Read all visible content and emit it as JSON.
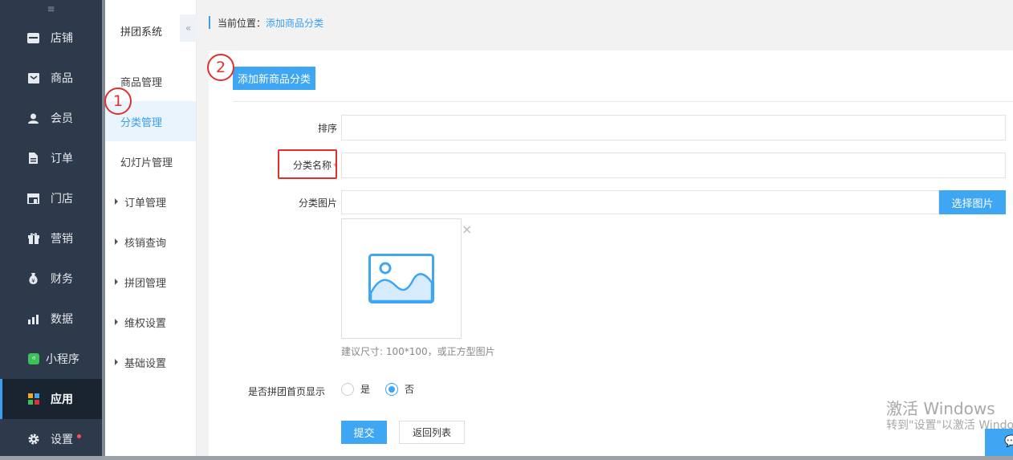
{
  "sidebar": {
    "toggle_icon": "≡",
    "items": [
      {
        "label": "店铺",
        "icon": "store-icon"
      },
      {
        "label": "商品",
        "icon": "goods-icon"
      },
      {
        "label": "会员",
        "icon": "member-icon"
      },
      {
        "label": "订单",
        "icon": "order-icon"
      },
      {
        "label": "门店",
        "icon": "shop-icon"
      },
      {
        "label": "营销",
        "icon": "gift-icon"
      },
      {
        "label": "财务",
        "icon": "money-icon"
      },
      {
        "label": "数据",
        "icon": "chart-icon"
      },
      {
        "label": "小程序",
        "icon": "miniapp-icon"
      },
      {
        "label": "应用",
        "icon": "apps-icon",
        "active": true
      },
      {
        "label": "设置",
        "icon": "gear-icon",
        "dot": true
      }
    ]
  },
  "submenu": {
    "title": "拼团系统",
    "collapse_icon": "«",
    "items": [
      {
        "label": "商品管理"
      },
      {
        "label": "分类管理",
        "active": true
      },
      {
        "label": "幻灯片管理"
      }
    ],
    "groups": [
      {
        "label": "订单管理"
      },
      {
        "label": "核销查询"
      },
      {
        "label": "拼团管理"
      },
      {
        "label": "维权设置"
      },
      {
        "label": "基础设置"
      }
    ]
  },
  "breadcrumb": {
    "prefix": "当前位置：",
    "current": "添加商品分类"
  },
  "main": {
    "add_button": "添加新商品分类",
    "sort_label": "排序",
    "sort_value": "",
    "name_label": "分类名称",
    "required_mark": "*",
    "name_value": "",
    "image_label": "分类图片",
    "image_value": "",
    "pick_button": "选择图片",
    "close_mark": "×",
    "image_hint": "建议尺寸: 100*100，或正方型图片",
    "show_label": "是否拼团首页显示",
    "radio_yes": "是",
    "radio_no": "否",
    "selected": "否",
    "submit_button": "提交",
    "back_button": "返回列表"
  },
  "annotations": {
    "badge1": "1",
    "badge2": "2"
  },
  "watermark": {
    "line1": "激活 Windows",
    "line2": "转到\"设置\"以激活 Windows。"
  },
  "colors": {
    "sidebar_bg": "#2d3a4b",
    "accent": "#3ea6f2",
    "annotation_red": "#e0302e"
  }
}
